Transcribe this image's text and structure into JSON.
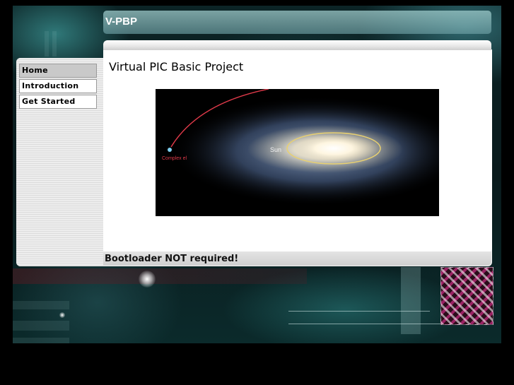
{
  "site": {
    "title": "V-PBP"
  },
  "nav": {
    "items": [
      {
        "label": "Home",
        "active": true
      },
      {
        "label": "Introduction",
        "active": false
      },
      {
        "label": "Get Started",
        "active": false
      }
    ]
  },
  "main": {
    "heading": "Virtual PIC Basic Project",
    "image": {
      "labels": {
        "sun": "Sun",
        "complex": "Complex el"
      }
    }
  },
  "footer": {
    "text": "Bootloader NOT required!"
  },
  "colors": {
    "background": "#000000",
    "teal_accent": "#3b8f90",
    "nav_active": "#c9c9c9",
    "orbit_red": "#e03a4a",
    "orbit_yellow": "#e8d070"
  }
}
